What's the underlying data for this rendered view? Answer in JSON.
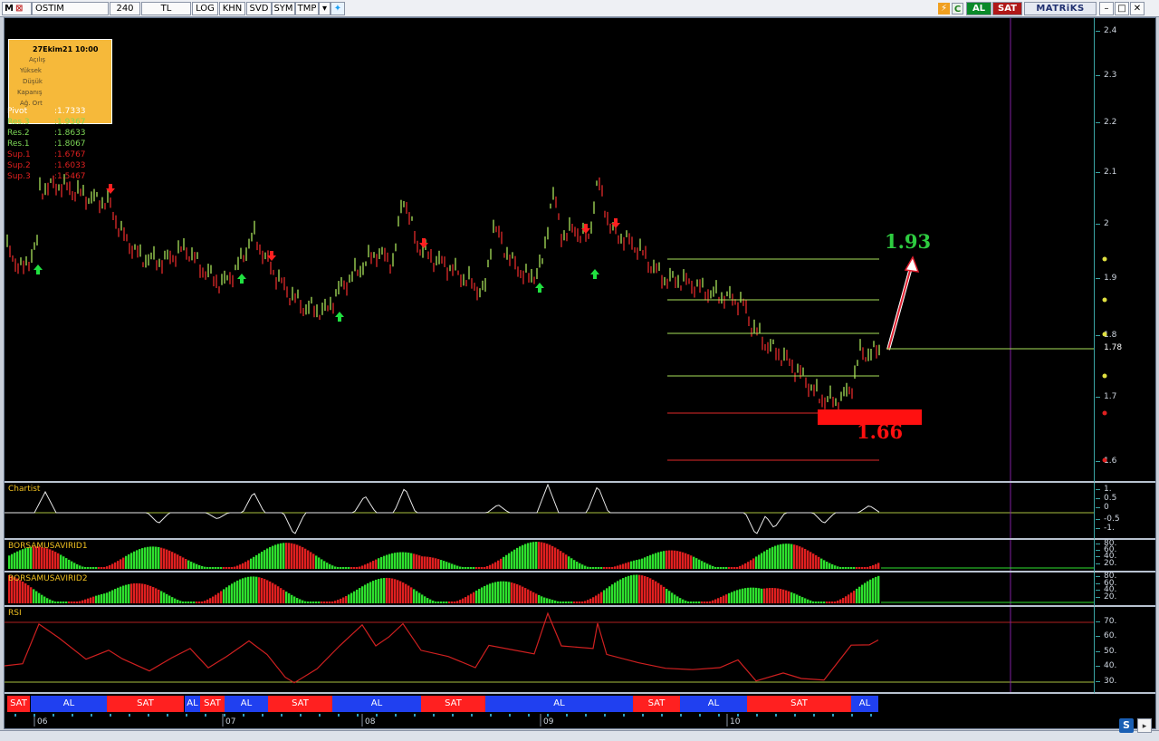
{
  "toolbar": {
    "logo": "M",
    "symbol": "OSTIM",
    "period": "240",
    "currency": "TL",
    "buttons": [
      "LOG",
      "KHN",
      "SVD",
      "SYM",
      "TMP"
    ],
    "right_al": "AL",
    "right_sat": "SAT",
    "brand": "MATRiKS",
    "icons": [
      "flash-icon",
      "refresh-icon",
      "twitter-icon",
      "dropdown-icon"
    ]
  },
  "info": {
    "timestamp": "27Ekim21 10:00",
    "fields": [
      "Açılış",
      "Yüksek",
      "Düşük",
      "Kapanış",
      "Ağ. Ort"
    ]
  },
  "pivots": [
    {
      "name": "Pivot",
      "value": ":1.7333",
      "color": "#ffffff"
    },
    {
      "name": "Res.3",
      "value": ":1.9367",
      "color": "#7ed957"
    },
    {
      "name": "Res.2",
      "value": ":1.8633",
      "color": "#7ed957"
    },
    {
      "name": "Res.1",
      "value": ":1.8067",
      "color": "#7ed957"
    },
    {
      "name": "Sup.1",
      "value": ":1.6767",
      "color": "#e02020"
    },
    {
      "name": "Sup.2",
      "value": ":1.6033",
      "color": "#e02020"
    },
    {
      "name": "Sup.3",
      "value": ":1.5467",
      "color": "#e02020"
    }
  ],
  "price_axis": {
    "ticks": [
      "2.4",
      "2.3",
      "2.2",
      "2.1",
      "2",
      "1.9",
      "1.8",
      "1.7",
      "1.6"
    ],
    "current": "1.78"
  },
  "annotations": {
    "target": "1.93",
    "support": "1.66"
  },
  "panels": {
    "chartist": {
      "label": "Chartist",
      "ticks": [
        "1.",
        "0.5",
        "0",
        "-0.5",
        "-1."
      ]
    },
    "bm1": {
      "label": "BORSAMUSAVIRID1",
      "ticks": [
        "80.",
        "60.",
        "40.",
        "20."
      ]
    },
    "bm2": {
      "label": "BORSAMUSAVIRID2",
      "ticks": [
        "80.",
        "60.",
        "40.",
        "20."
      ]
    },
    "rsi": {
      "label": "RSI",
      "ticks": [
        "70.",
        "60.",
        "50.",
        "40.",
        "30."
      ]
    }
  },
  "signals": [
    {
      "label": "SAT",
      "type": "sat"
    },
    {
      "label": "AL",
      "type": "al"
    },
    {
      "label": "SAT",
      "type": "sat"
    },
    {
      "label": "AL",
      "type": "al"
    },
    {
      "label": "SAT",
      "type": "sat"
    },
    {
      "label": "AL",
      "type": "al"
    },
    {
      "label": "SAT",
      "type": "sat"
    },
    {
      "label": "AL",
      "type": "al"
    },
    {
      "label": "SAT",
      "type": "sat"
    },
    {
      "label": "AL",
      "type": "al"
    },
    {
      "label": "SAT",
      "type": "sat"
    },
    {
      "label": "AL",
      "type": "al"
    },
    {
      "label": "SAT",
      "type": "sat"
    },
    {
      "label": "AL",
      "type": "al"
    }
  ],
  "dates": [
    "06",
    "07",
    "08",
    "09",
    "10"
  ],
  "colors": {
    "up": "#a8e05a",
    "down": "#e02a2a",
    "sat_bg": "#ff2020",
    "al_bg": "#2040f0",
    "rsi": "#d02020",
    "histo_green": "#2ee02e",
    "histo_red": "#e02020"
  }
}
